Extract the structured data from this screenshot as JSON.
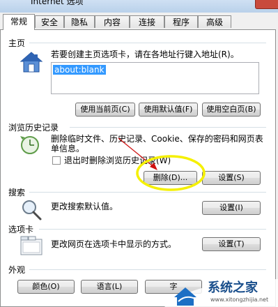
{
  "window": {
    "title_fragment": "Internet 选项"
  },
  "tabs": [
    "常规",
    "安全",
    "隐私",
    "内容",
    "连接",
    "程序",
    "高级"
  ],
  "homepage": {
    "label": "主页",
    "description": "若要创建主页选项卡，请在各地址行键入地址(R)。",
    "address": "about:blank",
    "btn_current": "使用当前页(C)",
    "btn_default": "使用默认值(F)",
    "btn_blank": "使用空白页(B)"
  },
  "history": {
    "label": "浏览历史记录",
    "description": "删除临时文件、历史记录、Cookie、保存的密码和网页表单信息。",
    "checkbox_label": "退出时删除浏览历史记录(W)",
    "checkbox_checked": false,
    "btn_delete": "删除(D)...",
    "btn_settings": "设置(S)"
  },
  "search": {
    "label": "搜索",
    "description": "更改搜索默认值。",
    "btn_settings": "设置(I)"
  },
  "tabs_section": {
    "label": "选项卡",
    "description": "更改网页在选项卡中显示的方式。",
    "btn_settings": "设置(T)"
  },
  "appearance": {
    "label": "外观",
    "btn_colors": "颜色(O)",
    "btn_languages": "语言(L)",
    "btn_fonts": "字"
  },
  "watermark": {
    "text": "系统之家",
    "url": "www.xitongzhijia.net"
  },
  "colors": {
    "highlight": "#3399ff",
    "annotation_circle": "#f5f000",
    "annotation_arrow": "#d01010"
  }
}
